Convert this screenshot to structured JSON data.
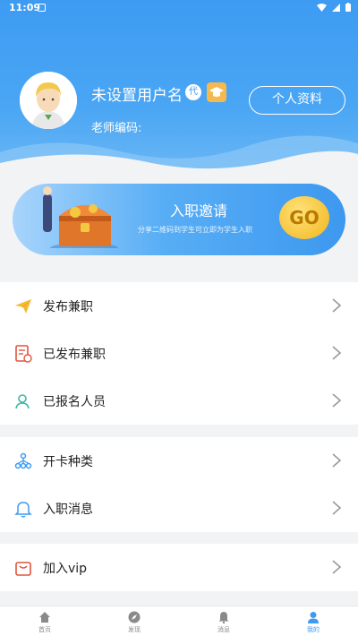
{
  "status_bar": {
    "time": "11:09"
  },
  "profile": {
    "username": "未设置用户名",
    "badge_text": "代",
    "teacher_code_label": "老师编码:",
    "profile_button": "个人资料"
  },
  "banner": {
    "title": "入职邀请",
    "subtitle": "分享二维码到学生可立即为学生入职",
    "go_label": "GO"
  },
  "menu_groups": [
    {
      "items": [
        {
          "label": "发布兼职",
          "icon": "paper-plane-icon"
        },
        {
          "label": "已发布兼职",
          "icon": "document-icon"
        },
        {
          "label": "已报名人员",
          "icon": "people-icon"
        }
      ]
    },
    {
      "items": [
        {
          "label": "开卡种类",
          "icon": "tree-structure-icon"
        },
        {
          "label": "入职消息",
          "icon": "bell-icon"
        }
      ]
    },
    {
      "items": [
        {
          "label": "加入vip",
          "icon": "bag-icon"
        }
      ]
    }
  ],
  "tabbar": [
    {
      "label": "首页",
      "icon": "home-icon",
      "active": false
    },
    {
      "label": "发现",
      "icon": "compass-icon",
      "active": false
    },
    {
      "label": "消息",
      "icon": "bell-icon",
      "active": false
    },
    {
      "label": "我的",
      "icon": "user-icon",
      "active": true
    }
  ],
  "colors": {
    "primary": "#3d9bf2",
    "accent_gold": "#f5b94e"
  }
}
